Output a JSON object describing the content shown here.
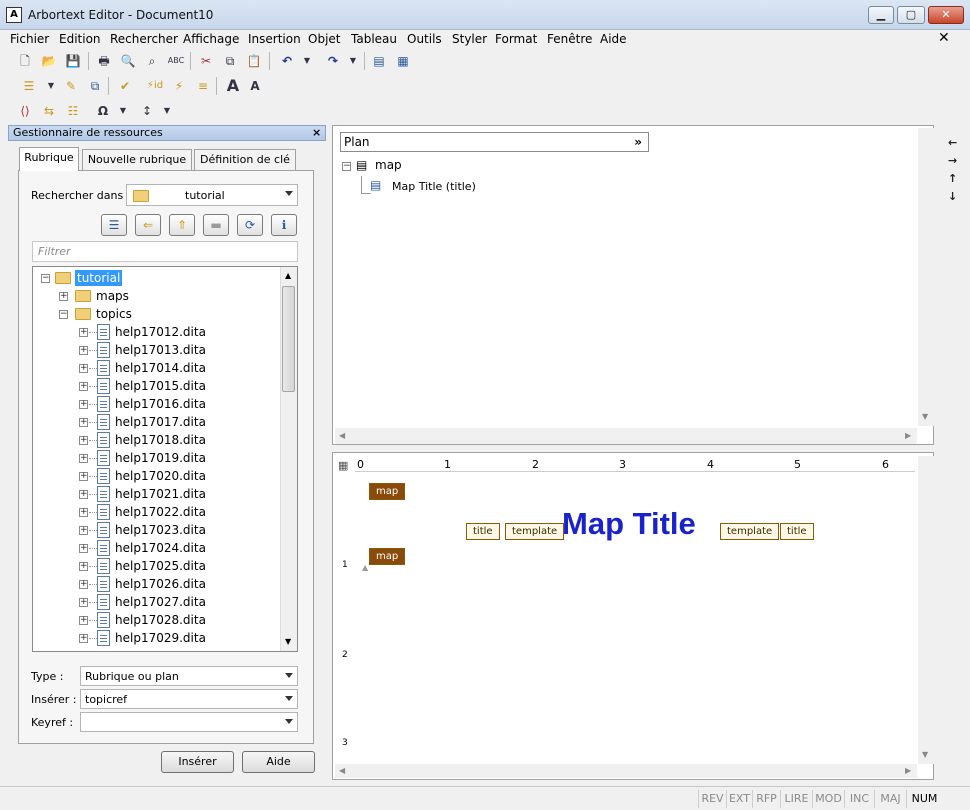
{
  "window": {
    "title": "Arbortext Editor - Document10",
    "app_icon": "A"
  },
  "window_buttons": {
    "minimize": "▁",
    "maximize": "▢",
    "close": "✕"
  },
  "menu": [
    "Fichier",
    "Edition",
    "Rechercher",
    "Affichage",
    "Insertion",
    "Objet",
    "Tableau",
    "Outils",
    "Styler",
    "Format",
    "Fenêtre",
    "Aide"
  ],
  "menu_close": "✕",
  "resource_manager": {
    "title": "Gestionnaire de ressources",
    "close": "×",
    "tabs": [
      "Rubrique",
      "Nouvelle rubrique",
      "Définition de clé"
    ],
    "search_label": "Rechercher dans :",
    "search_value": "tutorial",
    "filter_placeholder": "Filtrer",
    "tree": {
      "root": "tutorial",
      "children": [
        "maps",
        "topics"
      ],
      "files": [
        "help17012.dita",
        "help17013.dita",
        "help17014.dita",
        "help17015.dita",
        "help17016.dita",
        "help17017.dita",
        "help17018.dita",
        "help17019.dita",
        "help17020.dita",
        "help17021.dita",
        "help17022.dita",
        "help17023.dita",
        "help17024.dita",
        "help17025.dita",
        "help17026.dita",
        "help17027.dita",
        "help17028.dita",
        "help17029.dita"
      ]
    },
    "type_label": "Type :",
    "type_value": "Rubrique ou plan",
    "insert_label": "Insérer :",
    "insert_value": "topicref",
    "keyref_label": "Keyref :",
    "keyref_value": "",
    "insert_button": "Insérer",
    "help_button": "Aide"
  },
  "plan": {
    "header": "Plan",
    "header_more": "»",
    "root": "map",
    "child": "Map Title (title)"
  },
  "editor": {
    "tag_map_open": "map",
    "tag_title_open": "title",
    "tag_template_open": "template",
    "map_title": "Map Title",
    "tag_template_close": "template",
    "tag_title_close": "title",
    "tag_map_close": "map",
    "ruler_h": [
      "0",
      "1",
      "2",
      "3",
      "4",
      "5",
      "6"
    ],
    "ruler_v": [
      "1",
      "2",
      "3"
    ]
  },
  "side_tools": [
    "←",
    "→",
    "↑",
    "↓"
  ],
  "status": [
    "REV",
    "EXT",
    "RFP",
    "LIRE",
    "MOD",
    "INC",
    "MAJ",
    "NUM"
  ]
}
